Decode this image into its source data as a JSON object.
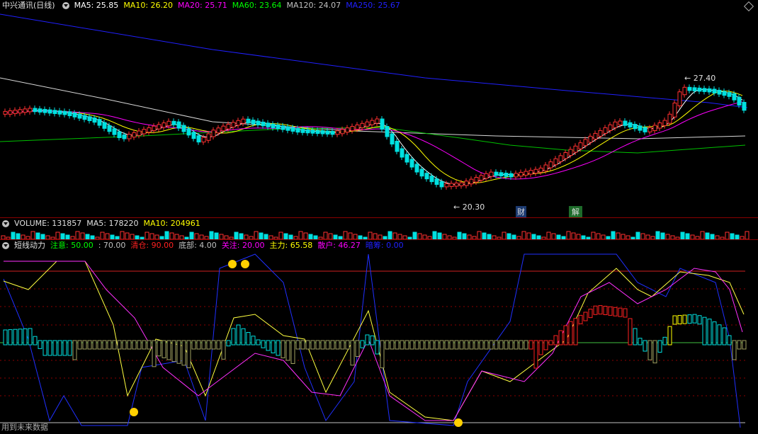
{
  "price": {
    "title": "中兴通讯(日线)",
    "ma": [
      {
        "label": "MA5: 25.85",
        "color": "#ffffff"
      },
      {
        "label": "MA10: 26.20",
        "color": "#ffff00"
      },
      {
        "label": "MA20: 25.71",
        "color": "#ff00ff"
      },
      {
        "label": "MA60: 23.64",
        "color": "#00ff00"
      },
      {
        "label": "MA120: 24.07",
        "color": "#c0c0c0"
      },
      {
        "label": "MA250: 25.67",
        "color": "#2020ff"
      }
    ],
    "high_label": "27.40",
    "low_label": "20.30",
    "marker_cai": "财",
    "marker_jie": "解"
  },
  "volume": {
    "title": "VOLUME: 131857",
    "ma5": "MA5: 178220",
    "ma10": "MA10: 204961"
  },
  "indicator": {
    "title": "短线动力",
    "items": [
      {
        "label": "注意: 50.00",
        "color": "#00ff00"
      },
      {
        "label": ": 70.00",
        "color": "#c0c0c0"
      },
      {
        "label": "清仓: 90.00",
        "color": "#ff2020"
      },
      {
        "label": "底部: 4.00",
        "color": "#c0c0c0"
      },
      {
        "label": "关注: 20.00",
        "color": "#ff00ff"
      },
      {
        "label": "主力: 65.58",
        "color": "#ffff00"
      },
      {
        "label": "散户: 46.27",
        "color": "#ff00ff"
      },
      {
        "label": "暗筹: 0.00",
        "color": "#2020ff"
      }
    ],
    "footer": "用到未来数据"
  },
  "colors": {
    "up": "#ff3030",
    "down": "#00e0e0",
    "grid": "#8b0000",
    "bg": "#000000"
  }
}
